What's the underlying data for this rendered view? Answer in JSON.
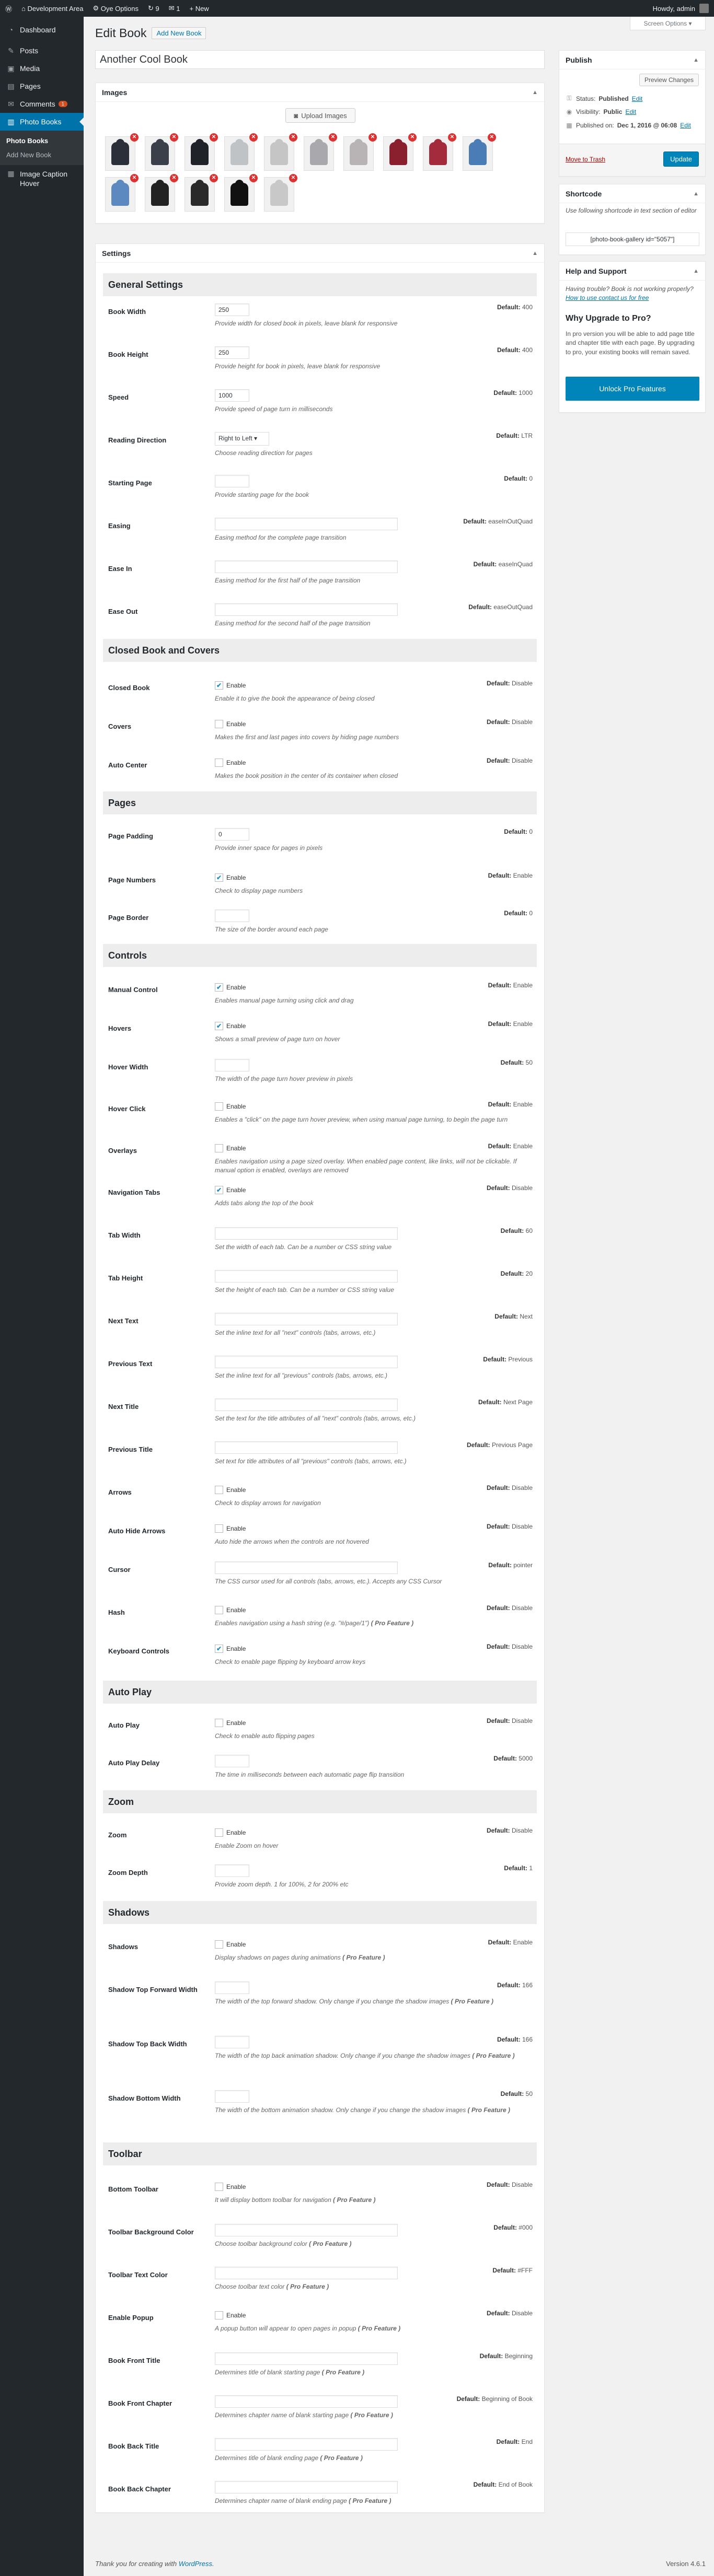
{
  "adminbar": {
    "site_name": "Development Area",
    "plugin_menu": "Oye Options",
    "updates": "9",
    "comments": "1",
    "new_label": "+ New",
    "howdy": "Howdy, admin"
  },
  "sidebar": {
    "items": [
      {
        "label": "Dashboard",
        "icon": "dashboard-icon",
        "glyph": "◔"
      },
      {
        "label": "Posts",
        "icon": "pin-icon",
        "glyph": "✎"
      },
      {
        "label": "Media",
        "icon": "media-icon",
        "glyph": "▣"
      },
      {
        "label": "Pages",
        "icon": "page-icon",
        "glyph": "▤"
      },
      {
        "label": "Comments",
        "icon": "comment-icon",
        "glyph": "✉"
      },
      {
        "label": "Photo Books",
        "icon": "book-icon",
        "glyph": "▥"
      },
      {
        "label": "Image Caption Hover",
        "icon": "image-icon",
        "glyph": "▦"
      }
    ],
    "comments_badge": "1",
    "submenu": [
      "Photo Books",
      "Add New Book"
    ]
  },
  "screen_options": "Screen Options ▾",
  "page": {
    "heading": "Edit Book",
    "add_new": "Add New Book",
    "post_title": "Another Cool Book"
  },
  "images_box": {
    "title": "Images",
    "upload_label": "Upload Images",
    "hoodie_colors": [
      "#2a2f3a",
      "#3b3f4a",
      "#1f2228",
      "#bfc3c6",
      "#c5c5c5",
      "#a9a9ad",
      "#b8b3b5",
      "#8a1f2e",
      "#a32b3b",
      "#4a7cb5",
      "#5b89c0",
      "#222",
      "#2a2a2a",
      "#111",
      "#c8c8c8"
    ]
  },
  "settings_box": {
    "title": "Settings"
  },
  "sections": [
    {
      "title": "General Settings"
    },
    {
      "title": "Closed Book and Covers"
    },
    {
      "title": "Pages"
    },
    {
      "title": "Controls"
    },
    {
      "title": "Auto Play"
    },
    {
      "title": "Zoom"
    },
    {
      "title": "Shadows"
    },
    {
      "title": "Toolbar"
    }
  ],
  "rows": {
    "book_width": {
      "label": "Book Width",
      "value": "250",
      "desc": "Provide width for closed book in pixels, leave blank for responsive",
      "def_label": "Default:",
      "def": "400"
    },
    "book_height": {
      "label": "Book Height",
      "value": "250",
      "desc": "Provide height for book in pixels, leave blank for responsive",
      "def_label": "Default:",
      "def": "400"
    },
    "speed": {
      "label": "Speed",
      "value": "1000",
      "desc": "Provide speed of page turn in milliseconds",
      "def_label": "Default:",
      "def": "1000"
    },
    "reading_direction": {
      "label": "Reading Direction",
      "value": "Right to Left ▾",
      "desc": "Choose reading direction for pages",
      "def_label": "Default:",
      "def": "LTR"
    },
    "starting_page": {
      "label": "Starting Page",
      "value": "",
      "desc": "Provide starting page for the book",
      "def_label": "Default:",
      "def": "0"
    },
    "easing": {
      "label": "Easing",
      "value": "",
      "desc": "Easing method for the complete page transition",
      "def_label": "Default:",
      "def": "easeInOutQuad"
    },
    "ease_in": {
      "label": "Ease In",
      "value": "",
      "desc": "Easing method for the first half of the page transition",
      "def_label": "Default:",
      "def": "easeInQuad"
    },
    "ease_out": {
      "label": "Ease Out",
      "value": "",
      "desc": "Easing method for the second half of the page transition",
      "def_label": "Default:",
      "def": "easeOutQuad"
    },
    "closed_book": {
      "label": "Closed Book",
      "opt": "Enable",
      "checked": "✔",
      "desc": "Enable it to give the book the appearance of being closed",
      "def_label": "Default:",
      "def": "Disable"
    },
    "covers": {
      "label": "Covers",
      "opt": "Enable",
      "checked": "",
      "desc": "Makes the first and last pages into covers by hiding page numbers",
      "def_label": "Default:",
      "def": "Disable"
    },
    "auto_center": {
      "label": "Auto Center",
      "opt": "Enable",
      "checked": "",
      "desc": "Makes the book position in the center of its container when closed",
      "def_label": "Default:",
      "def": "Disable"
    },
    "page_padding": {
      "label": "Page Padding",
      "value": "0",
      "desc": "Provide inner space for pages in pixels",
      "def_label": "Default:",
      "def": "0"
    },
    "page_numbers": {
      "label": "Page Numbers",
      "opt": "Enable",
      "checked": "✔",
      "desc": "Check to display page numbers",
      "def_label": "Default:",
      "def": "Enable"
    },
    "page_border": {
      "label": "Page Border",
      "value": "",
      "desc": "The size of the border around each page",
      "def_label": "Default:",
      "def": "0"
    },
    "manual_control": {
      "label": "Manual Control",
      "opt": "Enable",
      "checked": "✔",
      "desc": "Enables manual page turning using click and drag",
      "def_label": "Default:",
      "def": "Enable"
    },
    "hovers": {
      "label": "Hovers",
      "opt": "Enable",
      "checked": "✔",
      "desc": "Shows a small preview of page turn on hover",
      "def_label": "Default:",
      "def": "Enable"
    },
    "hover_width": {
      "label": "Hover Width",
      "value": "",
      "desc": "The width of the page turn hover preview in pixels",
      "def_label": "Default:",
      "def": "50"
    },
    "hover_click": {
      "label": "Hover Click",
      "opt": "Enable",
      "checked": "",
      "desc": "Enables a \"click\" on the page turn hover preview, when using manual page turning, to begin the page turn",
      "def_label": "Default:",
      "def": "Enable"
    },
    "overlays": {
      "label": "Overlays",
      "opt": "Enable",
      "checked": "",
      "desc": "Enables navigation using a page sized overlay. When enabled page content, like links, will not be clickable. If manual option is enabled, overlays are removed",
      "def_label": "Default:",
      "def": "Enable"
    },
    "navigation_tabs": {
      "label": "Navigation Tabs",
      "opt": "Enable",
      "checked": "✔",
      "desc": "Adds tabs along the top of the book",
      "def_label": "Default:",
      "def": "Disable"
    },
    "tab_width": {
      "label": "Tab Width",
      "value": "",
      "desc": "Set the width of each tab. Can be a number or CSS string value",
      "def_label": "Default:",
      "def": "60"
    },
    "tab_height": {
      "label": "Tab Height",
      "value": "",
      "desc": "Set the height of each tab. Can be a number or CSS string value",
      "def_label": "Default:",
      "def": "20"
    },
    "next_text": {
      "label": "Next Text",
      "value": "",
      "desc": "Set the inline text for all \"next\" controls (tabs, arrows, etc.)",
      "def_label": "Default:",
      "def": "Next"
    },
    "previous_text": {
      "label": "Previous Text",
      "value": "",
      "desc": "Set the inline text for all \"previous\" controls (tabs, arrows, etc.)",
      "def_label": "Default:",
      "def": "Previous"
    },
    "next_title": {
      "label": "Next Title",
      "value": "",
      "desc": "Set the text for the title attributes of all \"next\" controls (tabs, arrows, etc.)",
      "def_label": "Default:",
      "def": "Next Page"
    },
    "previous_title": {
      "label": "Previous Title",
      "value": "",
      "desc": "Set text for title attributes of all \"previous\" controls (tabs, arrows, etc.)",
      "def_label": "Default:",
      "def": "Previous Page"
    },
    "arrows": {
      "label": "Arrows",
      "opt": "Enable",
      "checked": "",
      "desc": "Check to display arrows for navigation",
      "def_label": "Default:",
      "def": "Disable"
    },
    "auto_hide_arrows": {
      "label": "Auto Hide Arrows",
      "opt": "Enable",
      "checked": "",
      "desc": "Auto hide the arrows when the controls are not hovered",
      "def_label": "Default:",
      "def": "Disable"
    },
    "cursor": {
      "label": "Cursor",
      "value": "",
      "desc": "The CSS cursor used for all controls (tabs, arrows, etc.). Accepts any CSS Cursor",
      "def_label": "Default:",
      "def": "pointer"
    },
    "hash": {
      "label": "Hash",
      "opt": "Enable",
      "desc": "Enables navigation using a hash string (e.g. \"#/page/1\")",
      "pro": "( Pro Feature )",
      "def_label": "Default:",
      "def": "Disable"
    },
    "keyboard_controls": {
      "label": "Keyboard Controls",
      "opt": "Enable",
      "checked": "✔",
      "desc": "Check to enable page flipping by keyboard arrow keys",
      "def_label": "Default:",
      "def": "Disable"
    },
    "auto_play": {
      "label": "Auto Play",
      "opt": "Enable",
      "checked": "",
      "desc": "Check to enable auto flipping pages",
      "def_label": "Default:",
      "def": "Disable"
    },
    "auto_play_delay": {
      "label": "Auto Play Delay",
      "value": "",
      "desc": "The time in milliseconds between each automatic page flip transition",
      "def_label": "Default:",
      "def": "5000"
    },
    "zoom": {
      "label": "Zoom",
      "opt": "Enable",
      "checked": "",
      "desc": "Enable Zoom on hover",
      "def_label": "Default:",
      "def": "Disable"
    },
    "zoom_depth": {
      "label": "Zoom Depth",
      "value": "",
      "desc": "Provide zoom depth. 1 for 100%, 2 for 200% etc",
      "def_label": "Default:",
      "def": "1"
    },
    "shadows": {
      "label": "Shadows",
      "opt": "Enable",
      "desc": "Display shadows on pages during animations",
      "pro": "( Pro Feature )",
      "def_label": "Default:",
      "def": "Enable"
    },
    "shadow_top_forward": {
      "label": "Shadow Top Forward Width",
      "value": "",
      "desc": "The width of the top forward shadow. Only change if you change the shadow images",
      "pro": "( Pro Feature )",
      "def_label": "Default:",
      "def": "166"
    },
    "shadow_top_back": {
      "label": "Shadow Top Back Width",
      "value": "",
      "desc": "The width of the top back animation shadow. Only change if you change the shadow images",
      "pro": "( Pro Feature )",
      "def_label": "Default:",
      "def": "166"
    },
    "shadow_bottom": {
      "label": "Shadow Bottom Width",
      "value": "",
      "desc": "The width of the bottom animation shadow. Only change if you change the shadow images",
      "pro": "( Pro Feature )",
      "def_label": "Default:",
      "def": "50"
    },
    "bottom_toolbar": {
      "label": "Bottom Toolbar",
      "opt": "Enable",
      "desc": "It will display bottom toolbar for navigation",
      "pro": "( Pro Feature )",
      "def_label": "Default:",
      "def": "Disable"
    },
    "toolbar_bg": {
      "label": "Toolbar Background Color",
      "value": "",
      "desc": "Choose toolbar background color",
      "pro": "( Pro Feature )",
      "def_label": "Default:",
      "def": "#000"
    },
    "toolbar_text": {
      "label": "Toolbar Text Color",
      "value": "",
      "desc": "Choose toolbar text color",
      "pro": "( Pro Feature )",
      "def_label": "Default:",
      "def": "#FFF"
    },
    "enable_popup": {
      "label": "Enable Popup",
      "opt": "Enable",
      "desc": "A popup button will appear to open pages in popup",
      "pro": "( Pro Feature )",
      "def_label": "Default:",
      "def": "Disable"
    },
    "book_front_title": {
      "label": "Book Front Title",
      "value": "",
      "desc": "Determines title of blank starting page",
      "pro": "( Pro Feature )",
      "def_label": "Default:",
      "def": "Beginning"
    },
    "book_front_chapter": {
      "label": "Book Front Chapter",
      "value": "",
      "desc": "Determines chapter name of blank starting page",
      "pro": "( Pro Feature )",
      "def_label": "Default:",
      "def": "Beginning of Book"
    },
    "book_back_title": {
      "label": "Book Back Title",
      "value": "",
      "desc": "Determines title of blank ending page",
      "pro": "( Pro Feature )",
      "def_label": "Default:",
      "def": "End"
    },
    "book_back_chapter": {
      "label": "Book Back Chapter",
      "value": "",
      "desc": "Determines chapter name of blank ending page",
      "pro": "( Pro Feature )",
      "def_label": "Default:",
      "def": "End of Book"
    }
  },
  "publish": {
    "title": "Publish",
    "preview": "Preview Changes",
    "status_label": "Status:",
    "status": "Published",
    "visibility_label": "Visibility:",
    "visibility": "Public",
    "published_label": "Published on:",
    "published": "Dec 1, 2016 @ 06:08",
    "edit": "Edit",
    "trash": "Move to Trash",
    "update": "Update"
  },
  "shortcode": {
    "title": "Shortcode",
    "note": "Use following shortcode in text section of editor",
    "code": "[photo-book-gallery id=\"5057\"]"
  },
  "help": {
    "title": "Help and Support",
    "text": "Having trouble? Book is not working properly?",
    "link": "How to use contact us for free",
    "h2": "Why Upgrade to Pro?",
    "ptext": "In pro version you will be able to add page title and chapter title with each page. By upgrading to pro, your existing books will remain saved.",
    "unlock": "Unlock Pro Features"
  },
  "footer": {
    "thanks": "Thank you for creating with",
    "wp": "WordPress",
    "version": "Version 4.6.1"
  }
}
